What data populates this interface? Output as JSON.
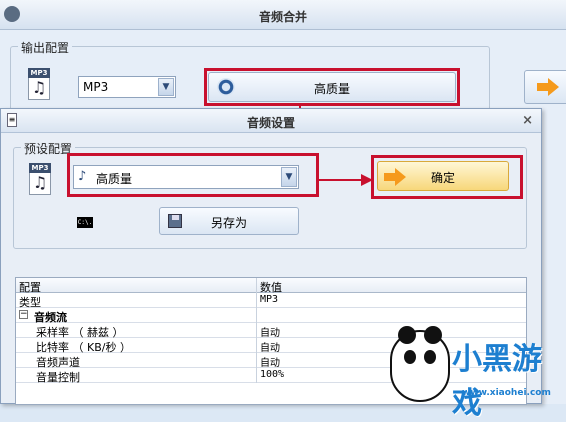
{
  "main_window": {
    "title": "音频合并",
    "output_group_label": "输出配置",
    "format_value": "MP3",
    "quality_button_label": "高质量"
  },
  "dialog": {
    "title": "音频设置",
    "close_label": "×",
    "preset_group_label": "预设配置",
    "preset_value": "高质量",
    "ok_button_label": "确定",
    "save_as_label": "另存为",
    "cmd_label": "C:\\.",
    "table": {
      "headers": [
        "配置",
        "数值"
      ],
      "rows": [
        {
          "name": "类型",
          "value": "MP3"
        },
        {
          "name": "音频流",
          "value": ""
        },
        {
          "name": "采样率 （ 赫兹 ）",
          "value": "自动"
        },
        {
          "name": "比特率 （ KB/秒 ）",
          "value": "自动"
        },
        {
          "name": "音频声道",
          "value": "自动"
        },
        {
          "name": "音量控制",
          "value": "100%"
        }
      ]
    }
  },
  "icons": {
    "file": "mp3-file-icon",
    "music_note": "music-note-icon",
    "save": "floppy-disk-icon",
    "arrow": "orange-arrow-icon"
  },
  "watermark": {
    "brand": "小黑游戏",
    "url": "www.xiaohei.com"
  },
  "colors": {
    "highlight": "#c8102e",
    "accent_orange": "#f59a1c"
  }
}
